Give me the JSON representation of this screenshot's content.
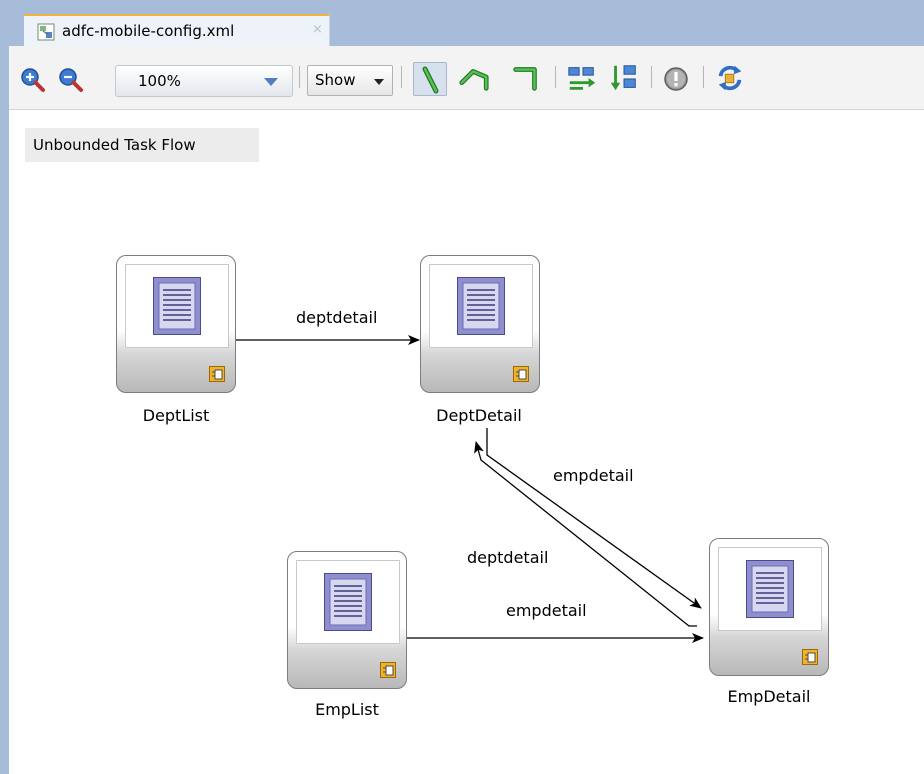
{
  "tab": {
    "title": "adfc-mobile-config.xml",
    "close_glyph": "×"
  },
  "toolbar": {
    "zoom_value": "100%",
    "show_label": "Show",
    "icons": [
      "zoom-in-icon",
      "zoom-out-icon",
      "straight-line-icon",
      "polyline-icon",
      "orthogonal-line-icon",
      "layout-horizontal-icon",
      "layout-vertical-icon",
      "validation-icon",
      "refresh-icon"
    ]
  },
  "canvas": {
    "flow_label": "Unbounded Task Flow",
    "nodes": {
      "deptlist": "DeptList",
      "deptdetail": "DeptDetail",
      "emplist": "EmpList",
      "empdetail": "EmpDetail"
    },
    "edges": {
      "deptlist_to_deptdetail": "deptdetail",
      "deptdetail_to_empdetail": "empdetail",
      "empdetail_to_deptdetail": "deptdetail",
      "emplist_to_empdetail": "empdetail"
    }
  },
  "colors": {
    "chrome_blue": "#a7bcd8",
    "tab_accent": "#f2b33d",
    "page_icon": "#8f8fd0",
    "badge": "#f1b32a"
  }
}
